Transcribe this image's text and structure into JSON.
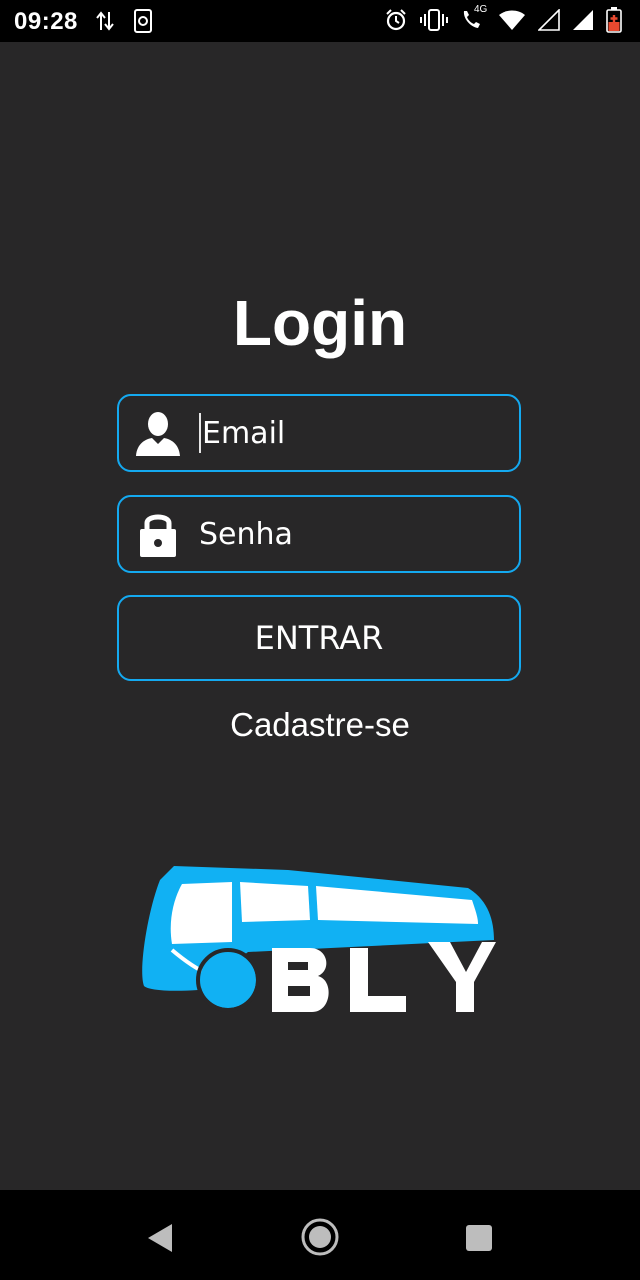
{
  "status_bar": {
    "time": "09:28",
    "network_label": "4G",
    "icons": [
      "data-transfer-icon",
      "screen-rotate-icon",
      "alarm-icon",
      "vibrate-icon",
      "wifi-call-icon",
      "wifi-icon",
      "signal-empty-icon",
      "signal-full-icon",
      "battery-low-icon"
    ],
    "battery_color": "#e8492f"
  },
  "login": {
    "title": "Login",
    "email_placeholder": "Email",
    "password_placeholder": "Senha",
    "submit_label": "ENTRAR",
    "register_link": "Cadastre-se"
  },
  "logo": {
    "text": "BLY",
    "accent": "#11b1f3"
  },
  "nav_bar": {
    "icons": [
      "back-icon",
      "home-icon",
      "recents-icon"
    ]
  },
  "colors": {
    "background": "#282728",
    "field_border": "#14a9f0"
  }
}
